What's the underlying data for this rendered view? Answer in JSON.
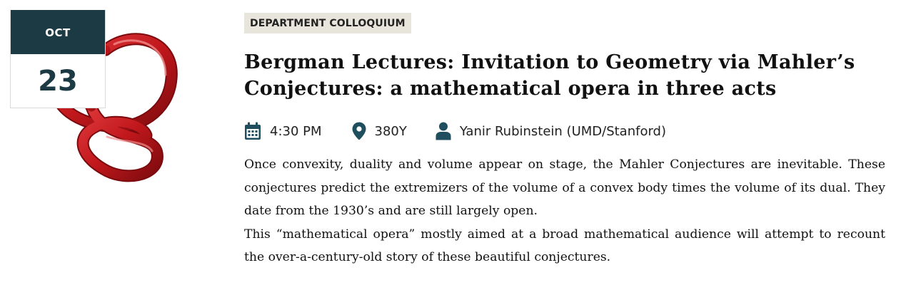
{
  "date": {
    "month": "OCT",
    "day": "23"
  },
  "category": "DEPARTMENT COLLOQUIUM",
  "title": "Bergman Lectures: Invitation to Geometry via Mahler’s Conjectures: a mathematical opera in three acts",
  "meta": {
    "time": "4:30 PM",
    "location": "380Y",
    "speaker": "Yanir Rubinstein (UMD/Stanford)"
  },
  "description": [
    "Once convexity, duality and volume appear on stage, the Mahler Conjectures are inevitable. These conjectures predict the extremizers of the volume of a convex body times the volume of its dual. They date from the 1930’s and are still largely open.",
    "This “mathematical opera” mostly aimed at a broad mathematical audience will attempt to recount the over-a-century-old story of these beautiful conjectures."
  ],
  "icons": {
    "time": "calendar-icon",
    "location": "map-pin-icon",
    "speaker": "person-icon",
    "image": "red-knot-illustration"
  },
  "colors": {
    "badge_dark": "#1c3a44",
    "tag_background": "#e8e6dc",
    "icon_color": "#1f4e5f",
    "knot_red": "#c0181c"
  }
}
